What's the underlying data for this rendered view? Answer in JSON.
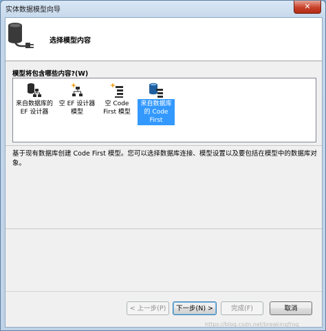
{
  "window": {
    "title": "实体数据模型向导",
    "close_glyph": "✕"
  },
  "header": {
    "title": "选择模型内容",
    "icon": "database-plug-icon"
  },
  "question": "模型将包含哪些内容?(W)",
  "model_options": [
    {
      "label_line1": "来自数据库的",
      "label_line2": "EF 设计器",
      "label_line3": "",
      "icon": "database-designer-icon",
      "selected": false
    },
    {
      "label_line1": "空 EF 设计器",
      "label_line2": "模型",
      "label_line3": "",
      "icon": "empty-designer-icon",
      "selected": false
    },
    {
      "label_line1": "空 Code",
      "label_line2": "First 模型",
      "label_line3": "",
      "icon": "empty-code-first-icon",
      "selected": false
    },
    {
      "label_line1": "来自数据库",
      "label_line2": "的 Code",
      "label_line3": "First",
      "icon": "database-code-first-icon",
      "selected": true
    }
  ],
  "description": "基于现有数据库创建 Code First 模型。您可以选择数据库连接、模型设置以及要包括在模型中的数据库对象。",
  "buttons": {
    "back": "< 上一步(P)",
    "next": "下一步(N) >",
    "finish": "完成(F)",
    "cancel": "取消"
  },
  "watermark": "https://blog.csdn.net/breakingfrog",
  "colors": {
    "selection": "#3399ff",
    "close": "#c7412a"
  }
}
